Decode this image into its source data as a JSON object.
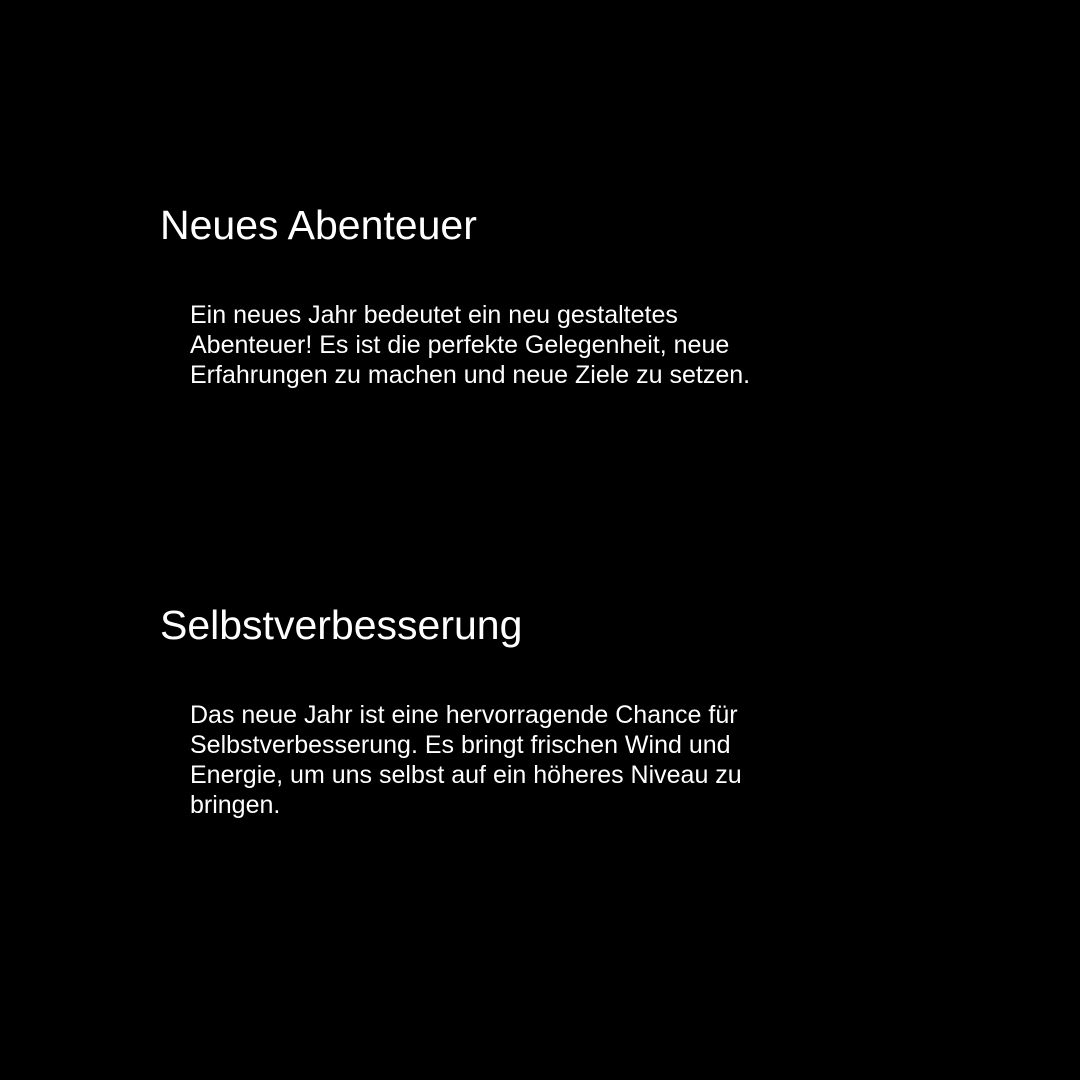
{
  "sections": [
    {
      "heading": "Neues Abenteuer",
      "lines": [
        "Ein neues Jahr bedeutet ein neu gestaltetes",
        "Abenteuer! Es ist die perfekte Gelegenheit, neue",
        "Erfahrungen zu machen und neue Ziele zu setzen."
      ]
    },
    {
      "heading": "Selbstverbesserung",
      "lines": [
        "Das neue Jahr ist eine hervorragende Chance für",
        "Selbstverbesserung. Es bringt frischen Wind und",
        "Energie, um uns selbst auf ein höheres Niveau zu",
        "bringen."
      ]
    }
  ],
  "colors": {
    "background": "#000000",
    "text": "#ffffff"
  }
}
